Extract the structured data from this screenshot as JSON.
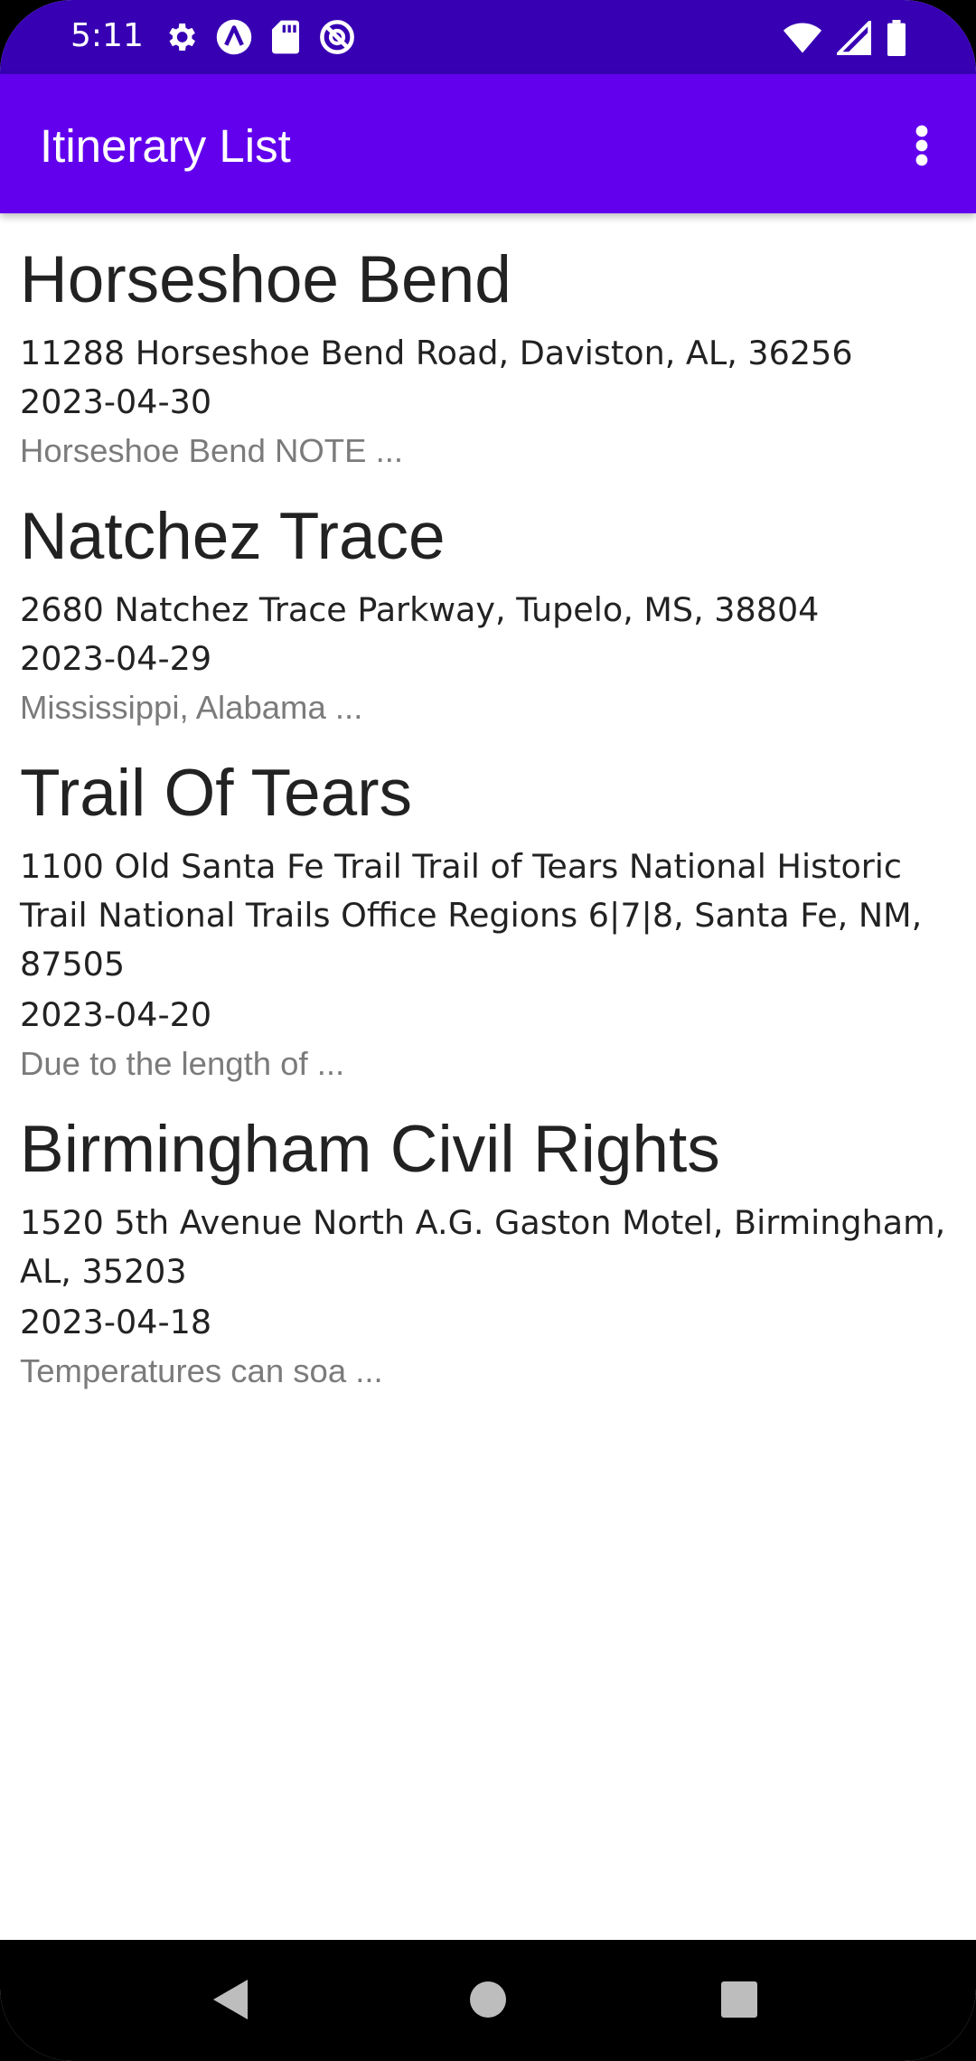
{
  "status_bar": {
    "time": "5:11",
    "left_icons": [
      "settings-icon",
      "a-circle-icon",
      "sd-card-icon",
      "no-sync-icon"
    ],
    "right_icons": [
      "wifi-icon",
      "signal-icon",
      "battery-icon"
    ]
  },
  "app_bar": {
    "title": "Itinerary List",
    "menu_icon": "more-vert-icon"
  },
  "itineraries": [
    {
      "name": "Horseshoe Bend",
      "address": "11288 Horseshoe Bend Road, Daviston, AL, 36256",
      "date": "2023-04-30",
      "note": "Horseshoe Bend NOTE ..."
    },
    {
      "name": "Natchez Trace",
      "address": "2680 Natchez Trace Parkway, Tupelo, MS, 38804",
      "date": "2023-04-29",
      "note": "Mississippi, Alabama ..."
    },
    {
      "name": "Trail Of Tears",
      "address": "1100 Old Santa Fe Trail Trail of Tears National Historic Trail National Trails Office Regions 6|7|8, Santa Fe, NM, 87505",
      "date": "2023-04-20",
      "note": "Due to the length of ..."
    },
    {
      "name": "Birmingham Civil Rights",
      "address": "1520 5th Avenue North A.G. Gaston Motel, Birmingham, AL, 35203",
      "date": "2023-04-18",
      "note": "Temperatures can soa ..."
    }
  ],
  "nav_bar": {
    "buttons": [
      "back-icon",
      "home-icon",
      "recents-icon"
    ]
  },
  "colors": {
    "status_bar": "#3700b3",
    "app_bar": "#6200ee",
    "primary_text": "#222222",
    "secondary_text": "#7b7b7b"
  }
}
